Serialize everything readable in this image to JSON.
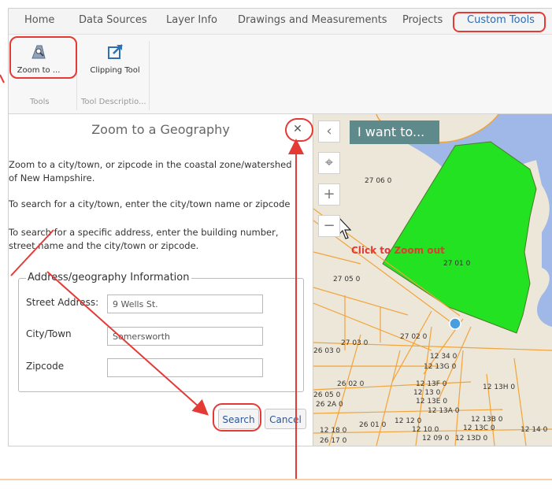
{
  "menu": {
    "tabs": [
      "Home",
      "Data Sources",
      "Layer Info",
      "Drawings and Measurements",
      "Projects",
      "Custom Tools"
    ],
    "active": "Custom Tools"
  },
  "ribbon": {
    "buttons": [
      {
        "label": "Zoom to ...",
        "icon": "zoom-to-icon"
      },
      {
        "label": "Clipping Tool",
        "icon": "clipping-tool-icon"
      }
    ],
    "groups": [
      "Tools",
      "Tool Descriptio..."
    ]
  },
  "panel": {
    "title": "Zoom to a Geography",
    "paragraphs": [
      "Zoom to a city/town, or zipcode in the coastal zone/watershed",
      "of New Hampshire.",
      "To search for a city/town, enter the city/town name or zipcode",
      "To search for a specific address, enter the building number,",
      "street name and the city/town or zipcode."
    ],
    "fieldset_legend": "Address/geography Information",
    "fields": [
      {
        "label": "Street Address:",
        "value": "9 Wells St."
      },
      {
        "label": "City/Town",
        "value": "Somersworth"
      },
      {
        "label": "Zipcode",
        "value": ""
      }
    ],
    "search_label": "Search",
    "cancel_label": "Cancel"
  },
  "map": {
    "i_want_to": "I want to...",
    "zoom_out_note": "Click to Zoom out",
    "parcel_labels": [
      "27 06 0",
      "27 05 0",
      "27 01 0",
      "27 03 0",
      "27 02 0",
      "26 03 0",
      "26 02 0",
      "26 05 0",
      "26 2A 0",
      "12 34 0",
      "12 13G 0",
      "12 13F 0",
      "12 13H 0",
      "12 13 0",
      "12 13E 0",
      "12 13A 0",
      "12 13B 0",
      "12 13C 0",
      "12 12 0",
      "12 10 0",
      "12 09 0",
      "12 13D 0",
      "26 01 0",
      "12 14 0",
      "12 18 0",
      "26 17 0"
    ],
    "colors": {
      "parcel_fill": "#22e222",
      "water": "#9fb8e8",
      "boundary": "#f2a33a",
      "annotation": "#e53935"
    }
  }
}
